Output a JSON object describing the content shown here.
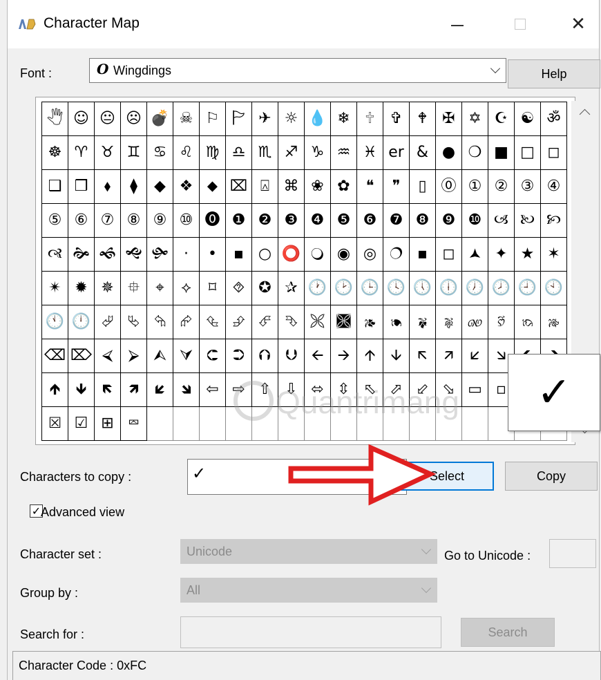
{
  "window": {
    "title": "Character Map",
    "close_glyph": "✕"
  },
  "font": {
    "label": "Font :",
    "value": "Wingdings",
    "icon": "opentype-font-icon",
    "icon_glyph": "O",
    "help_label": "Help"
  },
  "character_grid": {
    "rows": [
      [
        "🖑",
        "☺",
        "😐",
        "☹",
        "💣",
        "☠",
        "⚐",
        "🏱",
        "✈",
        "☼",
        "💧",
        "❄",
        "🕆",
        "✞",
        "🕈",
        "✠",
        "✡",
        "☪",
        "☯",
        "ॐ"
      ],
      [
        "☸",
        "♈",
        "♉",
        "♊",
        "♋",
        "♌",
        "♍",
        "♎",
        "♏",
        "♐",
        "♑",
        "♒",
        "♓",
        "er",
        "&",
        "●",
        "❍",
        "■",
        "□",
        "◻"
      ],
      [
        "❑",
        "❒",
        "⬧",
        "⧫",
        "◆",
        "❖",
        "⬥",
        "⌧",
        "⍓",
        "⌘",
        "❀",
        "✿",
        "❝",
        "❞",
        "▯",
        "⓪",
        "①",
        "②",
        "③",
        "④"
      ],
      [
        "⑤",
        "⑥",
        "⑦",
        "⑧",
        "⑨",
        "⑩",
        "⓿",
        "❶",
        "❷",
        "❸",
        "❹",
        "❺",
        "❻",
        "❼",
        "❽",
        "❾",
        "❿",
        "🙢",
        "🙠",
        "🙡"
      ],
      [
        "🙣",
        "🙞",
        "🙜",
        "🙝",
        "🙟",
        "·",
        "•",
        "▪",
        "○",
        "⭕",
        "🔾",
        "◉",
        "◎",
        "🔿",
        "▪",
        "◻",
        "🟂",
        "✦",
        "★",
        "✶"
      ],
      [
        "✴",
        "✹",
        "✵",
        "⯐",
        "⌖",
        "⟡",
        "⌑",
        "⯑",
        "✪",
        "✰",
        "🕐",
        "🕑",
        "🕒",
        "🕓",
        "🕔",
        "🕕",
        "🕖",
        "🕗",
        "🕘",
        "🕙"
      ],
      [
        "🕚",
        "🕛",
        "⮰",
        "⮱",
        "⮲",
        "⮳",
        "⮴",
        "⮵",
        "⮶",
        "⮷",
        "🙪",
        "🙫",
        "🙕",
        "🙔",
        "🙗",
        "🙖",
        "🙐",
        "🙑",
        "🙒",
        "🙓"
      ],
      [
        "⌫",
        "⌦",
        "⮘",
        "⮚",
        "⮙",
        "⮛",
        "⮈",
        "⮊",
        "⮉",
        "⮋",
        "🡨",
        "🡪",
        "🡩",
        "🡫",
        "🡬",
        "🡭",
        "🡯",
        "🡮",
        "🡸",
        "🡺"
      ],
      [
        "🡹",
        "🡻",
        "🡼",
        "🡽",
        "🡿",
        "🡾",
        "⇦",
        "⇨",
        "⇧",
        "⇩",
        "⬄",
        "⇳",
        "⬁",
        "⬀",
        "⬃",
        "⬂",
        "▭",
        "▫",
        "✗",
        "✓"
      ],
      [
        "⮽",
        "☑",
        "⊞",
        "⮹",
        "",
        "",
        "",
        "",
        "",
        "",
        "",
        "",
        "",
        "",
        "",
        "",
        "",
        "",
        "",
        ""
      ]
    ],
    "selected_char": "✓",
    "watermark_text": "Quantrimang"
  },
  "copy": {
    "label": "Characters to copy :",
    "value": "✓",
    "select_label": "Select",
    "copy_label": "Copy"
  },
  "advanced_view": {
    "label": "Advanced view",
    "checked": true,
    "check_glyph": "✓"
  },
  "character_set": {
    "label": "Character set :",
    "value": "Unicode"
  },
  "goto_unicode": {
    "label": "Go to Unicode :",
    "value": ""
  },
  "group_by": {
    "label": "Group by :",
    "value": "All"
  },
  "search": {
    "label": "Search for :",
    "value": "",
    "button_label": "Search"
  },
  "status": {
    "text": "Character Code : 0xFC"
  },
  "colors": {
    "accent": "#0078d7",
    "arrow": "#e02020"
  }
}
